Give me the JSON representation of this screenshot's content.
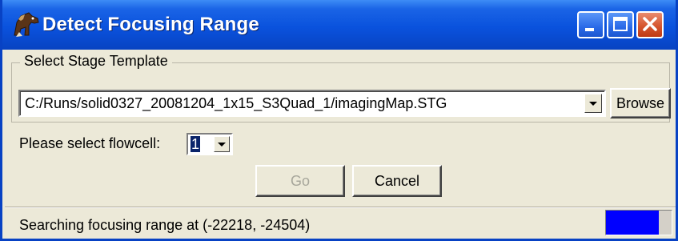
{
  "window": {
    "title": "Detect Focusing Range",
    "app_icon": "horse-icon",
    "controls": [
      "minimize-icon",
      "maximize-icon",
      "close-icon"
    ]
  },
  "stage_template": {
    "group_label": "Select Stage Template",
    "path": "C:/Runs/solid0327_20081204_1x15_S3Quad_1/imagingMap.STG",
    "browse_label": "Browse"
  },
  "flowcell": {
    "label": "Please select flowcell:",
    "value": "1"
  },
  "actions": {
    "go_label": "Go",
    "go_enabled": false,
    "cancel_label": "Cancel"
  },
  "status": {
    "text": "Searching focusing range at (-22218, -24504)",
    "progress_fraction": 0.8
  },
  "colors": {
    "titlebar": "#0a52dd",
    "progress": "#0000ff",
    "face": "#ece9d8"
  }
}
